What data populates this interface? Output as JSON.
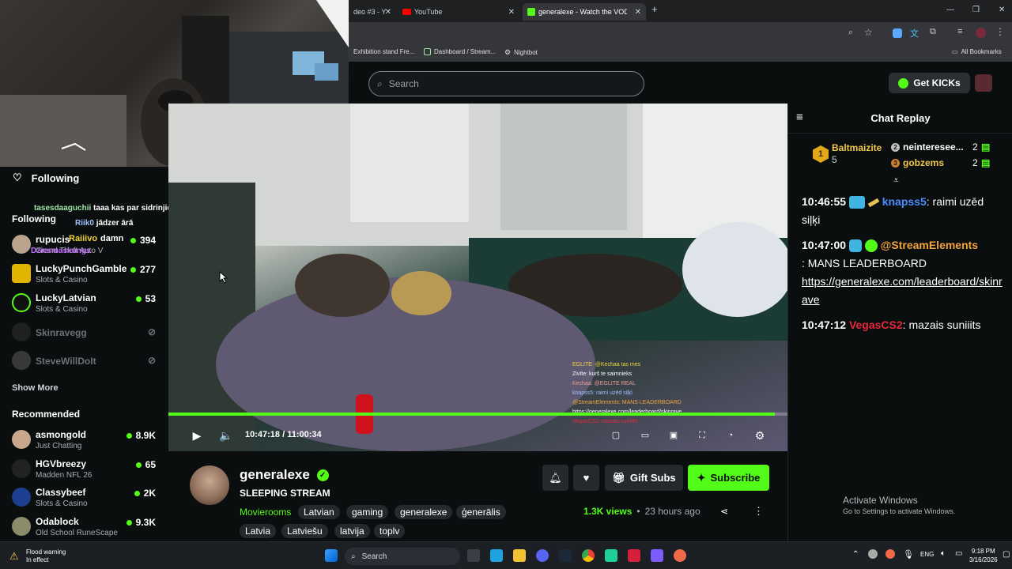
{
  "browser": {
    "tabs": [
      {
        "label": "deo #3 - Y",
        "active": false
      },
      {
        "label": "YouTube",
        "active": false
      },
      {
        "label": "generalexe - Watch the VOD o",
        "active": true
      }
    ],
    "new_tab": "+",
    "bookmarks": [
      "Exhibition stand Fre...",
      "Dashboard / Stream...",
      "Nightbot"
    ],
    "all_bookmarks": "All Bookmarks"
  },
  "header": {
    "search_placeholder": "Search",
    "get_kicks": "Get KICKs"
  },
  "sidebar": {
    "following_title": "Following",
    "following_section": "Following",
    "overlay_chat": [
      {
        "user": "tasesdaaguchii",
        "text": "taaa kas par sidrinjiem"
      },
      {
        "user": "Riik0",
        "text": "jādzer ārā"
      },
      {
        "user": "Raiiivo",
        "text": "damn"
      },
      {
        "user": "Dziesmaskungs",
        "text": ""
      }
    ],
    "following": [
      {
        "name": "rupucis",
        "category": "Grand Theft Auto V",
        "viewers": "394",
        "online": true
      },
      {
        "name": "LuckyPunchGamble",
        "category": "Slots & Casino",
        "viewers": "277",
        "online": true
      },
      {
        "name": "LuckyLatvian",
        "category": "Slots & Casino",
        "viewers": "53",
        "online": true
      },
      {
        "name": "Skinravegg",
        "category": "",
        "viewers": "",
        "online": false
      },
      {
        "name": "SteveWillDoIt",
        "category": "",
        "viewers": "",
        "online": false
      }
    ],
    "show_more": "Show More",
    "recommended_title": "Recommended",
    "recommended": [
      {
        "name": "asmongold",
        "category": "Just Chatting",
        "viewers": "8.9K"
      },
      {
        "name": "HGVbreezy",
        "category": "Madden NFL 26",
        "viewers": "65"
      },
      {
        "name": "Classybeef",
        "category": "Slots & Casino",
        "viewers": "2K"
      },
      {
        "name": "Odablock",
        "category": "Old School RuneScape",
        "viewers": "9.3K"
      }
    ]
  },
  "player": {
    "current_time": "10:47:18",
    "separator": "/",
    "duration": "11:00:34",
    "progress": 0.9798,
    "overlay_chat": [
      "EGLITE: @Kechaa tas mes",
      "Zivīte: kurš te saimnieks",
      "Kechaa: @EGLITE REAL",
      "knapss5: raimi uzēd siļķi",
      "@StreamElements: MANS LEADERBOARD",
      "https://generalexe.com/leaderboard/skinrave",
      "VegasCS2: mazais suniiits"
    ]
  },
  "chat": {
    "title": "Chat Replay",
    "gifters": [
      {
        "rank": "1",
        "name": "Baltmaizite",
        "count": "5"
      },
      {
        "rank": "2",
        "name": "neinteresee...",
        "count": "2"
      },
      {
        "rank": "3",
        "name": "gobzems",
        "count": "2"
      }
    ],
    "messages": [
      {
        "time": "10:46:55",
        "user": "knapss5",
        "text": "raimi uzēd siļķi",
        "color": "#4b8dff"
      },
      {
        "time": "10:47:00",
        "user": "@StreamElements",
        "text": "MANS LEADERBOARD",
        "link": "https://generalexe.com/leaderboard/skinrave",
        "color": "#f2a33a"
      },
      {
        "time": "10:47:12",
        "user": "VegasCS2",
        "text": "mazais suniiits",
        "color": "#e5283c"
      }
    ]
  },
  "channel": {
    "name": "generalexe",
    "title": "SLEEPING STREAM",
    "category": "Movierooms",
    "tags": [
      "Latvian",
      "gaming",
      "generalexe",
      "ģenerālis",
      "Latvia",
      "Latviešu",
      "latvija",
      "toplv"
    ],
    "gift_subs": "Gift Subs",
    "subscribe": "Subscribe",
    "views": "1.3K views",
    "ago": "23 hours ago"
  },
  "watermark": {
    "line1": "Activate Windows",
    "line2": "Go to Settings to activate Windows."
  },
  "taskbar": {
    "weather_title": "Flood warning",
    "weather_sub": "In effect",
    "search": "Search",
    "lang": "ENG",
    "time": "9:18 PM",
    "date": "3/16/2026"
  },
  "colors": {
    "accent": "#53fc18",
    "bg": "#0b0e0f"
  }
}
